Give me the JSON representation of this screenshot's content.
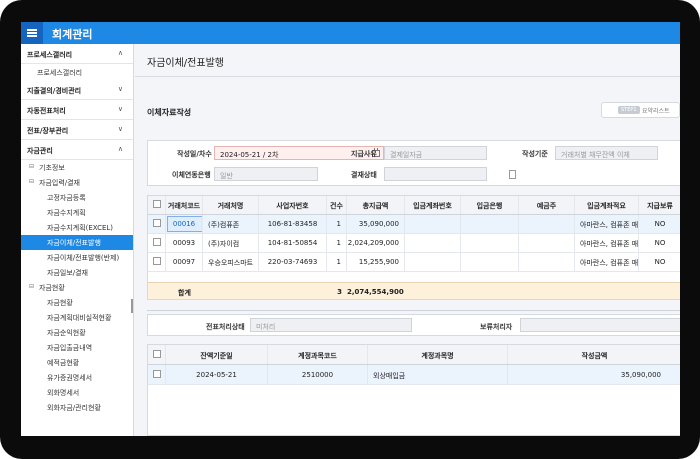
{
  "app": {
    "title": "회계관리"
  },
  "sidebar": {
    "groups": [
      {
        "label": "프로세스갤러리",
        "chev": "∧"
      },
      {
        "label": "지출결의/경비관리",
        "chev": "∨"
      },
      {
        "label": "자동전표처리",
        "chev": "∨"
      },
      {
        "label": "전표/장부관리",
        "chev": "∨"
      },
      {
        "label": "자금관리",
        "chev": "∧"
      }
    ],
    "gallery_item": "프로세스갤러리",
    "tree": {
      "basic": "기초정보",
      "payment": "자금입력/결재",
      "payment_items": [
        "고정자금등록",
        "자금수지계획",
        "자금수지계획(EXCEL)",
        "자금이체/전표발행",
        "자금이체/전표발행(반제)",
        "자금일보/결재"
      ],
      "status": "자금현황",
      "status_items": [
        "자금현황",
        "자금계획대비실적현황",
        "자금순익현황",
        "자금입출금내역",
        "예적금현황",
        "유가증권명세서",
        "외화명세서",
        "외화자금/관리현황"
      ]
    },
    "toggle_minus": "⊟"
  },
  "main": {
    "page_title": "자금이체/전표발행",
    "section_title": "이체자료작성",
    "step_tag": "STEP1",
    "step_label": "요약리스트"
  },
  "form": {
    "date_label": "작성일/차수",
    "date_value": "2024-05-21 / 2차",
    "reason_label": "지급사유",
    "reason_value": "결제일자금",
    "basis_label": "작성기준",
    "basis_value": "거래처별 채무잔액 이체",
    "bank_label": "이체연동은행",
    "bank_value": "일반",
    "approval_label": "결재상태",
    "approval_value": ""
  },
  "grid": {
    "headers": [
      "거래처코드",
      "거래처명",
      "사업자번호",
      "건수",
      "총지급액",
      "입금계좌번호",
      "입금은행",
      "예금주",
      "입금계좌적요",
      "지급보류"
    ],
    "rows": [
      {
        "code": "00016",
        "name": "(주)컴퓨존",
        "bizno": "106-81-83458",
        "count": "1",
        "amount": "35,090,000",
        "account": "",
        "bank": "",
        "holder": "",
        "memo": "아마란스, 컴퓨존 매입",
        "hold": "NO"
      },
      {
        "code": "00093",
        "name": "(주)자이컴",
        "bizno": "104-81-50854",
        "count": "1",
        "amount": "2,024,209,000",
        "account": "",
        "bank": "",
        "holder": "",
        "memo": "아마란스, 컴퓨존 매입",
        "hold": "NO"
      },
      {
        "code": "00097",
        "name": "우승오피스마트",
        "bizno": "220-03-74693",
        "count": "1",
        "amount": "15,255,900",
        "account": "",
        "bank": "",
        "holder": "",
        "memo": "아마란스, 컴퓨존 매입",
        "hold": "NO"
      }
    ],
    "summary": {
      "label": "합계",
      "count": "3",
      "amount": "2,074,554,900"
    }
  },
  "status": {
    "voucher_label": "전표처리상태",
    "voucher_value": "미처리",
    "hold_label": "보류처리자",
    "hold_value": ""
  },
  "grid2": {
    "headers": [
      "잔액기준일",
      "계정과목코드",
      "계정과목명",
      "작성금액"
    ],
    "rows": [
      {
        "date": "2024-05-21",
        "code": "2510000",
        "name": "외상매입금",
        "amount": "35,090,000"
      }
    ]
  }
}
